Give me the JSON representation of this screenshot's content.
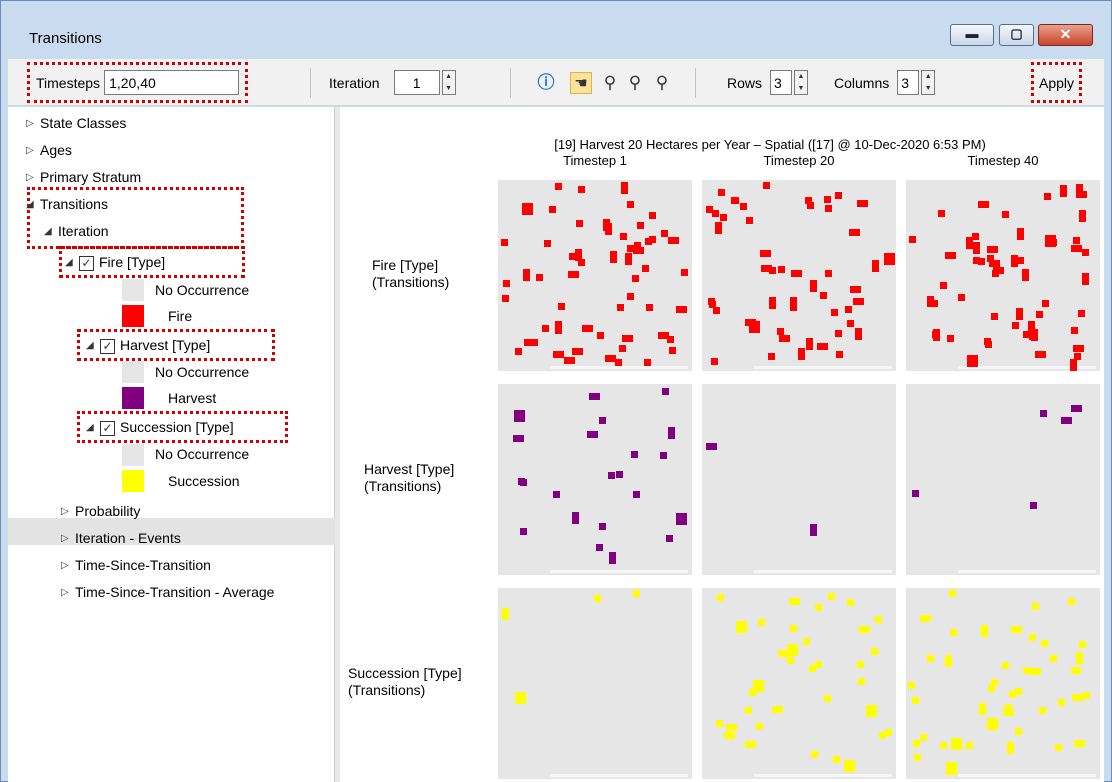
{
  "window": {
    "title": "Transitions",
    "minimize": "▬",
    "maximize": "▢",
    "close": "✕"
  },
  "toolbar": {
    "timesteps_label": "Timesteps",
    "timesteps_value": "1,20,40",
    "iteration_label": "Iteration",
    "iteration_value": "1",
    "rows_label": "Rows",
    "rows_value": "3",
    "columns_label": "Columns",
    "columns_value": "3",
    "apply_label": "Apply",
    "icons": [
      "info-icon",
      "pan-hand-icon",
      "zoom-out-icon",
      "zoom-in-icon",
      "zoom-reset-icon"
    ]
  },
  "tree": {
    "state_classes": "State Classes",
    "ages": "Ages",
    "primary_stratum": "Primary Stratum",
    "transitions": "Transitions",
    "iteration": "Iteration",
    "fire_type": "Fire [Type]",
    "fire_no_occ": "No Occurrence",
    "fire": "Fire",
    "harvest_type": "Harvest [Type]",
    "harvest_no_occ": "No Occurrence",
    "harvest": "Harvest",
    "succession_type": "Succession [Type]",
    "succession_no_occ": "No Occurrence",
    "succession": "Succession",
    "probability": "Probability",
    "iteration_events": "Iteration - Events",
    "tst": "Time-Since-Transition",
    "tst_avg": "Time-Since-Transition - Average"
  },
  "colors": {
    "fire": "#ff0000",
    "harvest": "#800080",
    "succession": "#ffff00",
    "no_occurrence": "#e6e6e6"
  },
  "map": {
    "title": "[19] Harvest 20 Hectares per Year – Spatial ([17] @ 10-Dec-2020 6:53 PM)",
    "columns": [
      "Timestep 1",
      "Timestep 20",
      "Timestep 40"
    ],
    "rows": [
      {
        "line1": "Fire [Type]",
        "line2": "(Transitions)",
        "color": "#ff0000"
      },
      {
        "line1": "Harvest [Type]",
        "line2": "(Transitions)",
        "color": "#800080"
      },
      {
        "line1": "Succession [Type]",
        "line2": "(Transitions)",
        "color": "#ffff00"
      }
    ]
  }
}
